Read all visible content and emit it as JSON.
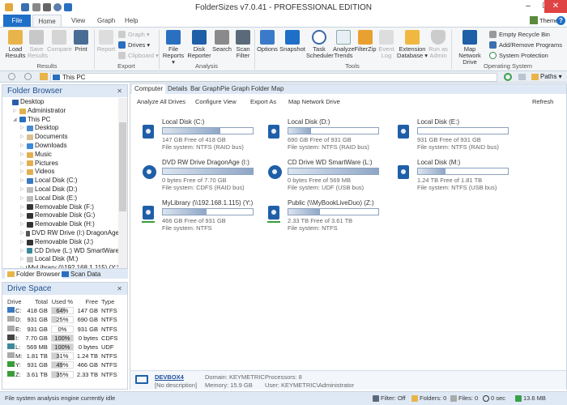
{
  "window": {
    "title": "FolderSizes v7.0.41 - PROFESSIONAL EDITION",
    "minimize": "–",
    "maximize": "☐",
    "close": "✕"
  },
  "ribbon_tabs": [
    "File",
    "Home",
    "View",
    "Graph",
    "Help"
  ],
  "ribbon_right": {
    "theme": "Theme ▾",
    "help": "?"
  },
  "ribbon": {
    "results": {
      "label": "Results",
      "load": "Load Results",
      "save": "Save Results",
      "compare": "Compare",
      "print": "Print"
    },
    "export": {
      "label": "Export",
      "report": "Report",
      "graph": "Graph ▾",
      "drives": "Drives ▾",
      "clipboard": "Clipboard ▾"
    },
    "analysis": {
      "label": "Analysis",
      "file_reports": "File Reports ▾",
      "disk_reporter": "Disk Reporter",
      "search": "Search",
      "scan_filter": "Scan Filter"
    },
    "tools": {
      "label": "Tools",
      "options": "Options",
      "snapshot": "Snapshot",
      "task_scheduler": "Task Scheduler",
      "analyze_trends": "Analyze Trends",
      "filterzip": "FilterZip",
      "event_log": "Event Log",
      "extension_database": "Extension Database ▾",
      "run_as_admin": "Run as Admin"
    },
    "os": {
      "label": "Operating System",
      "map_network_drive": "Map Network Drive",
      "empty_recycle_bin": "Empty Recycle Bin",
      "add_remove_programs": "Add/Remove Programs",
      "system_protection": "System Protection"
    }
  },
  "address": {
    "path": "This PC",
    "paths": "Paths ▾"
  },
  "folder_browser": {
    "title": "Folder Browser",
    "tabs": [
      "Folder Browser",
      "Scan Data"
    ],
    "items": [
      {
        "label": "Desktop",
        "level": 0,
        "color": "#2a5caa"
      },
      {
        "label": "Administrator",
        "level": 1,
        "color": "#e0b050"
      },
      {
        "label": "This PC",
        "level": 1,
        "color": "#2a6fc0"
      },
      {
        "label": "Desktop",
        "level": 2,
        "color": "#4a8ad0"
      },
      {
        "label": "Documents",
        "level": 2,
        "color": "#d8c090"
      },
      {
        "label": "Downloads",
        "level": 2,
        "color": "#3a8ad8"
      },
      {
        "label": "Music",
        "level": 2,
        "color": "#e0b050"
      },
      {
        "label": "Pictures",
        "level": 2,
        "color": "#e0b050"
      },
      {
        "label": "Videos",
        "level": 2,
        "color": "#e0b050"
      },
      {
        "label": "Local Disk (C:)",
        "level": 2,
        "color": "#3a7ac0"
      },
      {
        "label": "Local Disk (D:)",
        "level": 2,
        "color": "#bbb"
      },
      {
        "label": "Local Disk (E:)",
        "level": 2,
        "color": "#bbb"
      },
      {
        "label": "Removable Disk (F:)",
        "level": 2,
        "color": "#333"
      },
      {
        "label": "Removable Disk (G:)",
        "level": 2,
        "color": "#333"
      },
      {
        "label": "Removable Disk (H:)",
        "level": 2,
        "color": "#333"
      },
      {
        "label": "DVD RW Drive (I:) DragonAge",
        "level": 2,
        "color": "#555"
      },
      {
        "label": "Removable Disk (J:)",
        "level": 2,
        "color": "#333"
      },
      {
        "label": "CD Drive (L:) WD SmartWare",
        "level": 2,
        "color": "#3a8a9a"
      },
      {
        "label": "Local Disk (M:)",
        "level": 2,
        "color": "#bbb"
      },
      {
        "label": "MyLibrary (\\\\192.168.1.115) (Y:)",
        "level": 2,
        "color": "#3a9d3a"
      }
    ]
  },
  "drive_space": {
    "title": "Drive Space",
    "headers": [
      "Drive",
      "Total",
      "Used %",
      "Free",
      "Type"
    ],
    "rows": [
      {
        "drive": "C:",
        "total": "418 GB",
        "used": "64%",
        "used_pct": 64,
        "free": "147 GB",
        "type": "NTFS",
        "color": "#3a7ac0"
      },
      {
        "drive": "D:",
        "total": "931 GB",
        "used": "25%",
        "used_pct": 25,
        "free": "690 GB",
        "type": "NTFS",
        "color": "#aaa"
      },
      {
        "drive": "E:",
        "total": "931 GB",
        "used": "0%",
        "used_pct": 0,
        "free": "931 GB",
        "type": "NTFS",
        "color": "#aaa"
      },
      {
        "drive": "I:",
        "total": "7.70 GB",
        "used": "100%",
        "used_pct": 100,
        "free": "0 bytes",
        "type": "CDFS",
        "color": "#444"
      },
      {
        "drive": "L:",
        "total": "569 MB",
        "used": "100%",
        "used_pct": 100,
        "free": "0 bytes",
        "type": "UDF",
        "color": "#3a8a9a"
      },
      {
        "drive": "M:",
        "total": "1.81 TB",
        "used": "31%",
        "used_pct": 31,
        "free": "1.24 TB",
        "type": "NTFS",
        "color": "#aaa"
      },
      {
        "drive": "Y:",
        "total": "931 GB",
        "used": "49%",
        "used_pct": 49,
        "free": "466 GB",
        "type": "NTFS",
        "color": "#3a9d3a"
      },
      {
        "drive": "Z:",
        "total": "3.61 TB",
        "used": "35%",
        "used_pct": 35,
        "free": "2.33 TB",
        "type": "NTFS",
        "color": "#3a9d3a"
      }
    ]
  },
  "view_tabs": [
    "Computer",
    "Details",
    "Bar Graph",
    "Pie Graph",
    "Folder Map"
  ],
  "view_toolbar": {
    "analyze": "Analyze All Drives",
    "configure": "Configure View",
    "export": "Export As",
    "map": "Map Network Drive",
    "refresh": "Refresh"
  },
  "drives": [
    {
      "name": "Local Disk (C:)",
      "used_pct": 64,
      "free": "147 GB Free of 418 GB",
      "fs": "File system: NTFS (RAID bus)",
      "kind": "hdd"
    },
    {
      "name": "Local Disk (D:)",
      "used_pct": 25,
      "free": "690 GB Free of 931 GB",
      "fs": "File system: NTFS (RAID bus)",
      "kind": "hdd"
    },
    {
      "name": "Local Disk (E:)",
      "used_pct": 0,
      "free": "931 GB Free of 931 GB",
      "fs": "File system: NTFS (RAID bus)",
      "kind": "hdd"
    },
    {
      "name": "DVD RW Drive DragonAge (I:)",
      "used_pct": 100,
      "free": "0 bytes Free of 7.70 GB",
      "fs": "File system: CDFS (RAID bus)",
      "kind": "opt"
    },
    {
      "name": "CD Drive WD SmartWare (L:)",
      "used_pct": 100,
      "free": "0 bytes Free of 569 MB",
      "fs": "File system: UDF (USB bus)",
      "kind": "opt"
    },
    {
      "name": "Local Disk (M:)",
      "used_pct": 31,
      "free": "1.24 TB Free of 1.81 TB",
      "fs": "File system: NTFS (USB bus)",
      "kind": "hdd"
    },
    {
      "name": "MyLibrary (\\\\192.168.1.115) (Y:)",
      "used_pct": 49,
      "free": "466 GB Free of 931 GB",
      "fs": "File system: NTFS",
      "kind": "net"
    },
    {
      "name": "Public (\\\\MyBookLiveDuo) (Z:)",
      "used_pct": 35,
      "free": "2.33 TB Free of 3.61 TB",
      "fs": "File system: NTFS",
      "kind": "net"
    }
  ],
  "computer": {
    "name": "DEVBOX4",
    "description": "[No description]",
    "domain": "Domain: KEYMETRIC",
    "memory": "Memory: 15.9 GB",
    "processors": "Processors: 8",
    "user": "User: KEYMETRIC\\Administrator"
  },
  "status": {
    "message": "File system analysis engine currently idle",
    "filter": "Filter: Off",
    "folders": "Folders: 0",
    "files": "Files: 0",
    "time": "0 sec",
    "memory": "13.6 MB"
  }
}
